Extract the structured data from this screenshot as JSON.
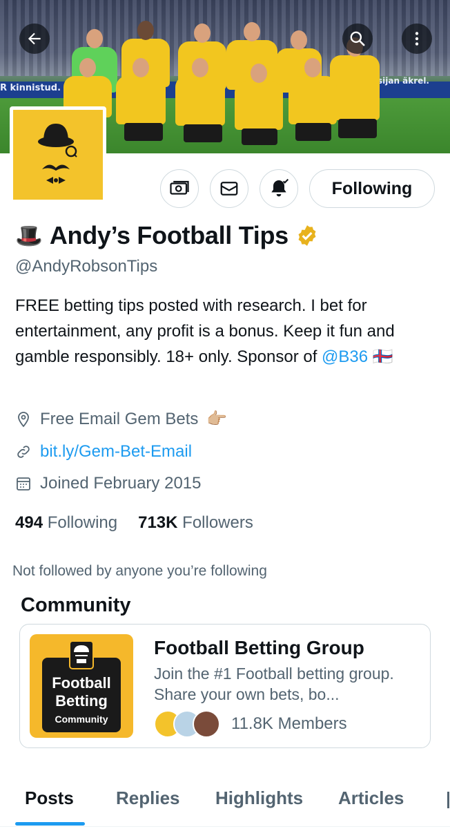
{
  "header": {
    "back_icon": "arrow-left-icon",
    "search_icon": "search-icon",
    "more_icon": "more-vertical-icon",
    "banner_ad_left": "R kinnistud. Si",
    "banner_ad_right": "ilisijan äkrel."
  },
  "profile": {
    "name_emoji": "🎩",
    "name": "Andy’s Football Tips",
    "verified_icon": "verified-badge-icon",
    "handle": "@AndyRobsonTips",
    "bio_text": "FREE betting tips posted with research. I bet for entertainment, any profit is a bonus. Keep it fun and gamble responsibly. 18+ only. Sponsor of ",
    "bio_mention": "@B36",
    "bio_flag": "🇫🇴",
    "location": "Free Email Gem Bets",
    "location_emoji": "👉🏼",
    "website": "bit.ly/Gem-Bet-Email",
    "joined": "Joined February 2015"
  },
  "actions": {
    "subscribe_icon": "money-icon",
    "message_icon": "envelope-icon",
    "notify_icon": "bell-check-icon",
    "follow_label": "Following"
  },
  "stats": {
    "following_count": "494",
    "following_label": "Following",
    "followers_count": "713K",
    "followers_label": "Followers"
  },
  "not_followed": "Not followed by anyone you’re following",
  "community": {
    "heading": "Community",
    "title": "Football Betting Group",
    "description": "Join the #1 Football betting group. Share your own bets, bo...",
    "members": "11.8K Members",
    "logo_lines": [
      "Football",
      "Betting",
      "Community"
    ]
  },
  "tabs": [
    {
      "label": "Posts",
      "active": true
    },
    {
      "label": "Replies",
      "active": false
    },
    {
      "label": "Highlights",
      "active": false
    },
    {
      "label": "Articles",
      "active": false
    }
  ],
  "colors": {
    "accent": "#1d9bf0",
    "muted": "#536471",
    "brand_yellow": "#f3c32b",
    "verified": "#e8b21d"
  }
}
